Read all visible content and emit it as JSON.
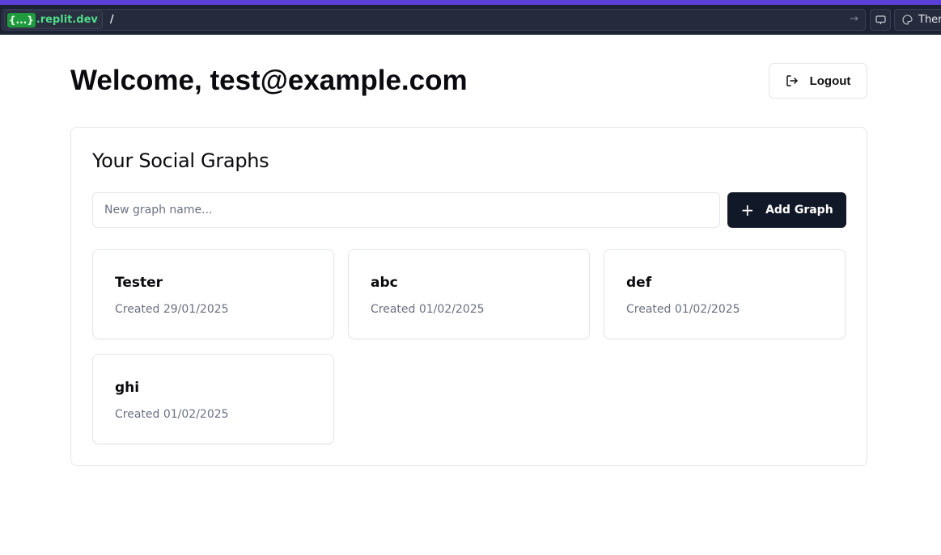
{
  "browser": {
    "domain_badge": "{...}",
    "domain_text": ".replit.dev",
    "path": "/",
    "go_icon": "arrow-right-icon",
    "devices_icon": "monitor-icon",
    "theme_icon": "palette-icon",
    "theme_label": "Ther",
    "accent_color": "#5a3fd8"
  },
  "header": {
    "welcome": "Welcome, test@example.com",
    "logout_label": "Logout",
    "logout_icon": "logout-icon"
  },
  "graphs_section": {
    "title": "Your Social Graphs",
    "input_placeholder": "New graph name...",
    "input_value": "",
    "add_label": "Add Graph",
    "add_icon": "plus-icon",
    "items": [
      {
        "name": "Tester",
        "created": "Created 29/01/2025"
      },
      {
        "name": "abc",
        "created": "Created 01/02/2025"
      },
      {
        "name": "def",
        "created": "Created 01/02/2025"
      },
      {
        "name": "ghi",
        "created": "Created 01/02/2025"
      }
    ]
  }
}
